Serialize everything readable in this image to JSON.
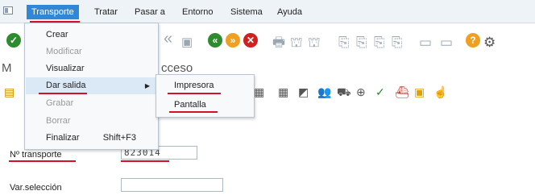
{
  "menubar": {
    "items": [
      {
        "label": "Transporte",
        "active": true
      },
      {
        "label": "Tratar",
        "active": false
      },
      {
        "label": "Pasar a",
        "active": false
      },
      {
        "label": "Entorno",
        "active": false
      },
      {
        "label": "Sistema",
        "active": false
      },
      {
        "label": "Ayuda",
        "active": false
      }
    ]
  },
  "title": {
    "prefix": "M",
    "text": "cceso"
  },
  "dropdown": {
    "items": [
      {
        "label": "Crear",
        "disabled": false
      },
      {
        "label": "Modificar",
        "disabled": true
      },
      {
        "label": "Visualizar",
        "disabled": false
      },
      {
        "label": "Dar salida",
        "disabled": false,
        "submenu": true
      },
      {
        "label": "Grabar",
        "disabled": true
      },
      {
        "label": "Borrar",
        "disabled": true
      },
      {
        "label": "Finalizar",
        "disabled": false,
        "shortcut": "Shift+F3"
      }
    ]
  },
  "submenu": {
    "items": [
      {
        "label": "Impresora"
      },
      {
        "label": "Pantalla"
      }
    ]
  },
  "form": {
    "transport_label": "Nº transporte",
    "transport_value": "823014",
    "varsel_label": "Var.selección",
    "varsel_value": ""
  },
  "colors": {
    "menu_active": "#2f87d6",
    "annotation_red": "#d3122a",
    "green_ok": "#2e8b2e"
  }
}
